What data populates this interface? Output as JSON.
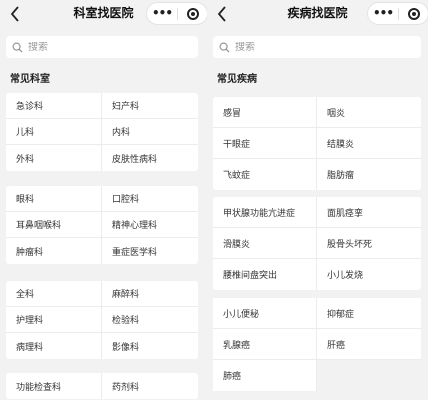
{
  "left": {
    "title": "科室找医院",
    "capsule_more": "•••",
    "search_placeholder": "搜索",
    "section_title": "常见科室",
    "groups": [
      [
        "急诊科",
        "妇产科",
        "儿科",
        "内科",
        "外科",
        "皮肤性病科"
      ],
      [
        "眼科",
        "口腔科",
        "耳鼻咽喉科",
        "精神心理科",
        "肿瘤科",
        "重症医学科"
      ],
      [
        "全科",
        "麻醉科",
        "护理科",
        "检验科",
        "病理科",
        "影像科"
      ],
      [
        "功能检查科",
        "药剂科"
      ]
    ]
  },
  "right": {
    "title": "疾病找医院",
    "capsule_more": "•••",
    "search_placeholder": "搜索",
    "section_title": "常见疾病",
    "groups": [
      [
        "感冒",
        "咽炎",
        "干眼症",
        "结膜炎",
        "飞蚊症",
        "脂肪瘤"
      ],
      [
        "甲状腺功能亢进症",
        "面肌痉挛",
        "滑膜炎",
        "股骨头坏死",
        "腰椎间盘突出",
        "小儿发烧"
      ],
      [
        "小儿便秘",
        "抑郁症",
        "乳腺癌",
        "肝癌",
        "肺癌"
      ]
    ]
  },
  "colors": {
    "background": "#f2f2f2",
    "card": "#ffffff",
    "divider": "#ececec"
  }
}
